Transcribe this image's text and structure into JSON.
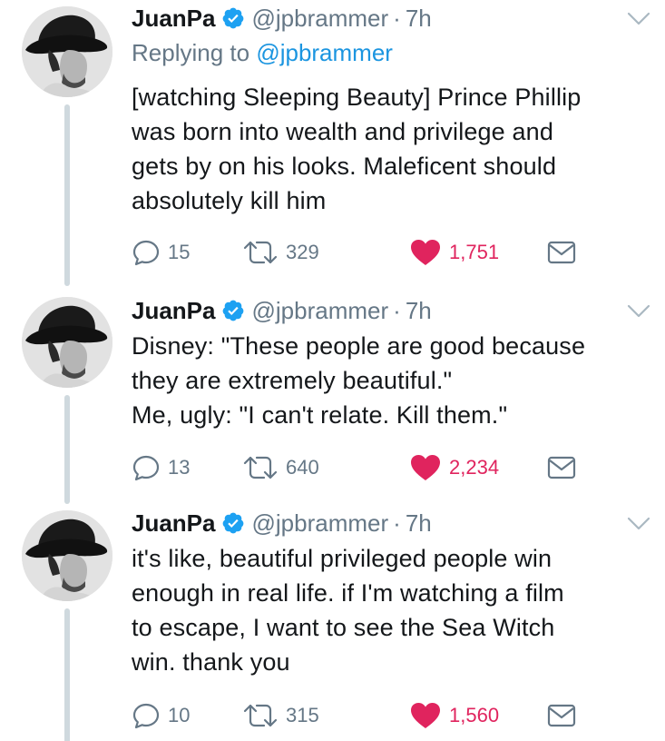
{
  "colors": {
    "like": "#e0245e",
    "link": "#1b95e0",
    "muted": "#657786",
    "verified": "#1da1f2"
  },
  "tweets": [
    {
      "name": "JuanPa",
      "handle": "@jpbrammer",
      "dot": "·",
      "time": "7h",
      "reply_prefix": "Replying to ",
      "reply_mention": "@jpbrammer",
      "text": "[watching Sleeping Beauty] Prince Phillip\nwas born into wealth and privilege and\ngets by on his looks. Maleficent should\nabsolutely kill him",
      "replies": "15",
      "retweets": "329",
      "likes": "1,751"
    },
    {
      "name": "JuanPa",
      "handle": "@jpbrammer",
      "dot": "·",
      "time": "7h",
      "text": "Disney: \"These people are good because\nthey are extremely beautiful.\"\nMe, ugly: \"I can't relate. Kill them.\"",
      "replies": "13",
      "retweets": "640",
      "likes": "2,234"
    },
    {
      "name": "JuanPa",
      "handle": "@jpbrammer",
      "dot": "·",
      "time": "7h",
      "text": "it's like, beautiful privileged people win\nenough in real life. if I'm watching a film\nto escape, I want to see the Sea Witch\nwin. thank you",
      "replies": "10",
      "retweets": "315",
      "likes": "1,560"
    }
  ],
  "icons": {
    "verified": "verified-badge-icon",
    "chevron": "chevron-down-icon",
    "reply": "reply-bubble-icon",
    "retweet": "retweet-icon",
    "like": "heart-icon",
    "dm": "envelope-icon"
  }
}
